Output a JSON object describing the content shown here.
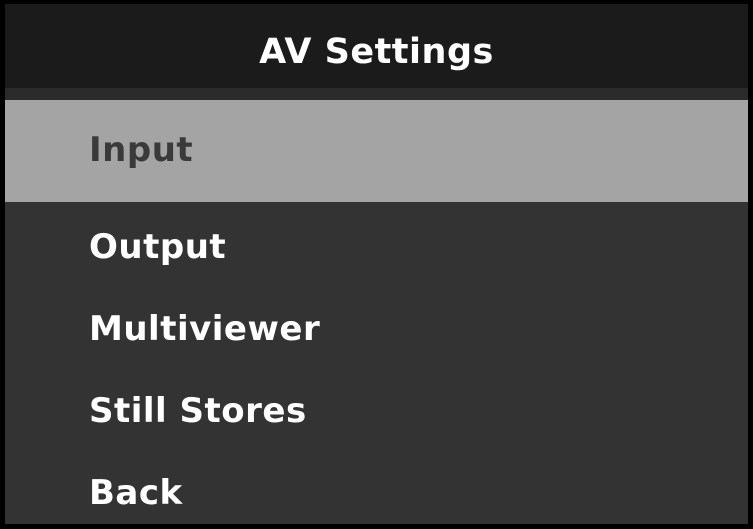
{
  "screen": {
    "title": "AV Settings",
    "colors": {
      "background": "#333333",
      "title_bar": "#1b1b1b",
      "selected_row": "#a4a4a4",
      "text": "#ffffff",
      "selected_text": "#3a3a3a"
    }
  },
  "menu": {
    "items": [
      {
        "label": "Input",
        "selected": true
      },
      {
        "label": "Output",
        "selected": false
      },
      {
        "label": "Multiviewer",
        "selected": false
      },
      {
        "label": "Still Stores",
        "selected": false
      },
      {
        "label": "Back",
        "selected": false
      }
    ]
  }
}
